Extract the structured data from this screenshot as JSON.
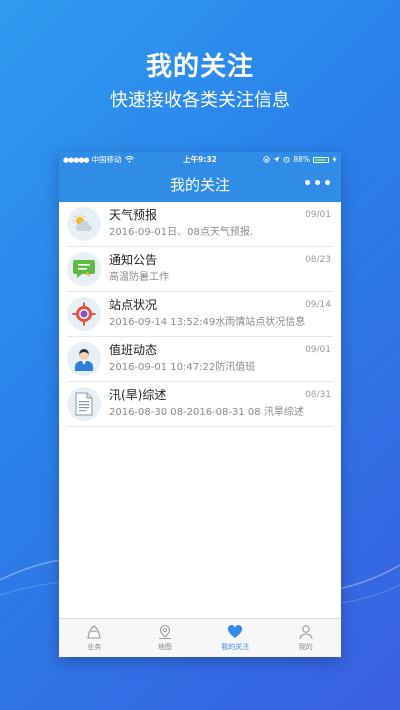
{
  "promo": {
    "title": "我的关注",
    "subtitle": "快速接收各类关注信息"
  },
  "status_bar": {
    "carrier": "中国移动",
    "time": "上午9:32",
    "battery_percent": "88%",
    "battery_level": 0.88
  },
  "nav": {
    "title": "我的关注",
    "more_icon": "more-icon"
  },
  "items": [
    {
      "title": "天气预报",
      "subtitle": "2016-09-01日、08点天气预报.",
      "date": "09/01",
      "icon": "weather-icon"
    },
    {
      "title": "通知公告",
      "subtitle": "高温防暑工作",
      "date": "08/23",
      "icon": "chat-bubble-icon"
    },
    {
      "title": "站点状况",
      "subtitle": "2016-09-14 13:52:49水雨情站点状况信息",
      "date": "09/14",
      "icon": "target-icon"
    },
    {
      "title": "值班动态",
      "subtitle": "2016-09-01 10:47:22防汛值班",
      "date": "09/01",
      "icon": "person-icon"
    },
    {
      "title": "汛(旱)综述",
      "subtitle": "2016-08-30 08-2016-08-31 08 汛旱综述",
      "date": "08/31",
      "icon": "document-icon"
    }
  ],
  "tabs": [
    {
      "label": "业务",
      "icon": "business-icon",
      "active": false
    },
    {
      "label": "地图",
      "icon": "map-pin-icon",
      "active": false
    },
    {
      "label": "我的关注",
      "icon": "heart-icon",
      "active": true
    },
    {
      "label": "我的",
      "icon": "user-icon",
      "active": false
    }
  ],
  "colors": {
    "accent": "#2f8de8",
    "background_top": "#2f9bf0",
    "background_bottom": "#3a5fe0"
  }
}
